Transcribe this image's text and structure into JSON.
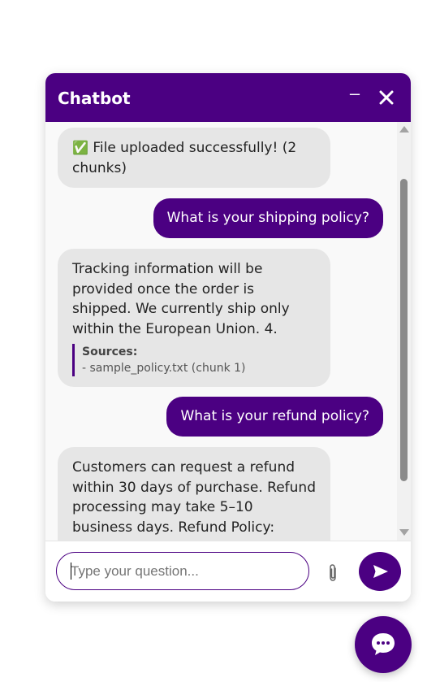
{
  "header": {
    "title": "Chatbot",
    "minimize_label": "–",
    "close_icon": "close-icon"
  },
  "messages": [
    {
      "role": "bot",
      "icon": "check-mark-icon",
      "icon_glyph": "✅",
      "text": "File uploaded successfully! (2 chunks)"
    },
    {
      "role": "user",
      "text": "What is your shipping policy?"
    },
    {
      "role": "bot",
      "text": "Tracking information will be provided once the order is shipped. We currently ship only within the European Union. 4.",
      "sources_title": "Sources:",
      "sources": [
        "- sample_policy.txt (chunk 1)"
      ]
    },
    {
      "role": "user",
      "text": "What is your refund policy?"
    },
    {
      "role": "bot",
      "text": "Customers can request a refund within 30 days of purchase. Refund processing may take 5–10 business days. Refund Policy:"
    }
  ],
  "input": {
    "placeholder": "Type your question...",
    "value": ""
  },
  "icons": {
    "attach": "paperclip-icon",
    "send": "send-icon",
    "launcher": "chat-bubble-icon"
  },
  "colors": {
    "accent": "#4b0082",
    "bot_bubble": "#e6e6e6",
    "background": "#f9f9f9"
  }
}
